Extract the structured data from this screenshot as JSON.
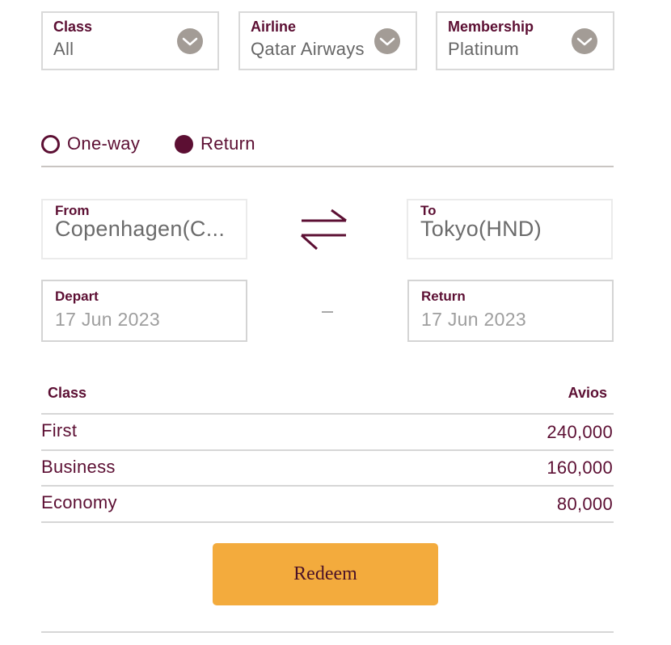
{
  "filters": {
    "class": {
      "label": "Class",
      "value": "All"
    },
    "airline": {
      "label": "Airline",
      "value": "Qatar Airways"
    },
    "membership": {
      "label": "Membership",
      "value": "Platinum"
    }
  },
  "trip_type": {
    "options": [
      {
        "label": "One-way",
        "selected": false
      },
      {
        "label": "Return",
        "selected": true
      }
    ]
  },
  "route": {
    "from": {
      "label": "From",
      "value": "Copenhagen(C..."
    },
    "to": {
      "label": "To",
      "value": "Tokyo(HND)"
    },
    "swap_icon": "swap-arrows-icon"
  },
  "dates": {
    "depart": {
      "label": "Depart",
      "value": "17 Jun 2023"
    },
    "return": {
      "label": "Return",
      "value": "17 Jun 2023"
    },
    "separator": "–"
  },
  "table": {
    "headers": {
      "class": "Class",
      "avios": "Avios"
    },
    "rows": [
      {
        "class": "First",
        "avios": "240,000"
      },
      {
        "class": "Business",
        "avios": "160,000"
      },
      {
        "class": "Economy",
        "avios": "80,000"
      }
    ]
  },
  "actions": {
    "redeem_label": "Redeem"
  },
  "colors": {
    "brand": "#5c0f33",
    "accent_button": "#f3ab3d",
    "chevron_bg": "#a39c96",
    "value_text": "#666666"
  }
}
